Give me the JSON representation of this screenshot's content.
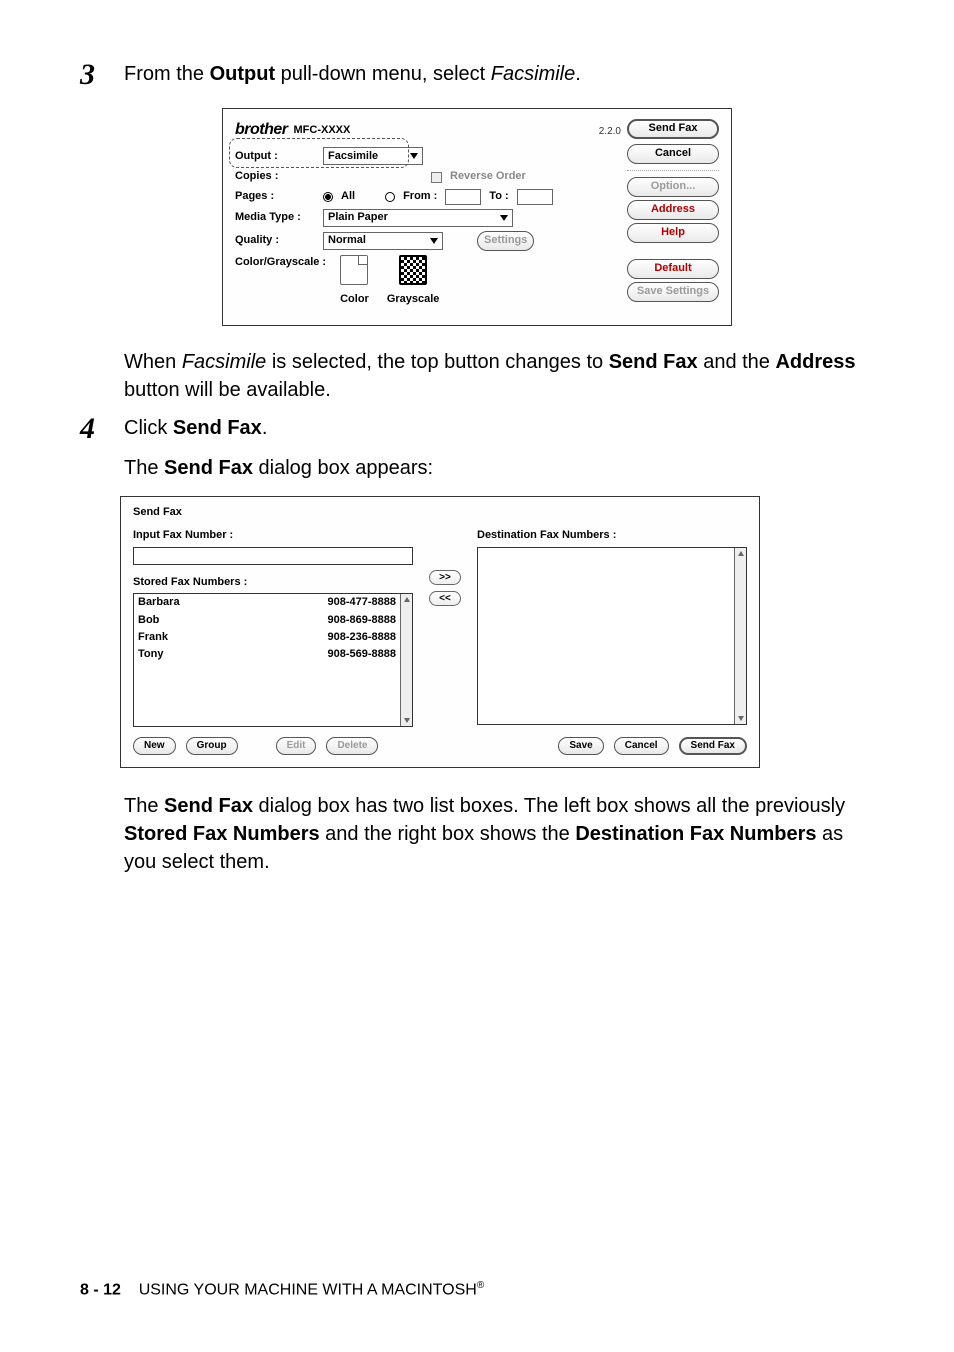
{
  "step3": {
    "num": "3",
    "pre": "From the ",
    "bold1": "Output",
    "mid": " pull-down menu, select ",
    "ital": "Facsimile",
    "post": "."
  },
  "dlg1": {
    "brand": "brother",
    "model": "MFC-XXXX",
    "version": "2.2.0",
    "labels": {
      "output": "Output :",
      "copies": "Copies :",
      "reverse": "Reverse Order",
      "pages": "Pages :",
      "all": "All",
      "from": "From :",
      "to": "To :",
      "media": "Media Type :",
      "quality": "Quality :",
      "settings_btn": "Settings",
      "cg": "Color/Grayscale :",
      "color": "Color",
      "grayscale": "Grayscale"
    },
    "values": {
      "output": "Facsimile",
      "media": "Plain Paper",
      "quality": "Normal"
    },
    "buttons": {
      "sendfax": "Send Fax",
      "cancel": "Cancel",
      "option": "Option...",
      "address": "Address",
      "help": "Help",
      "default": "Default",
      "save": "Save Settings"
    }
  },
  "para1": {
    "pre": "When ",
    "ital": "Facsimile",
    "mid1": " is selected, the top button changes to ",
    "bold1": "Send Fax",
    "mid2": " and the ",
    "bold2": "Address",
    "post": " button will be available."
  },
  "step4": {
    "num": "4",
    "pre": "Click ",
    "bold": "Send Fax",
    "post": "."
  },
  "para2": {
    "pre": "The ",
    "bold": "Send Fax",
    "post": " dialog box appears:"
  },
  "dlg2": {
    "title": "Send Fax",
    "labels": {
      "input": "Input Fax Number :",
      "stored": "Stored Fax Numbers :",
      "dest": "Destination Fax Numbers :",
      "add": ">>",
      "remove": "<<"
    },
    "stored": [
      {
        "name": "Barbara",
        "num": "908-477-8888"
      },
      {
        "name": "Bob",
        "num": "908-869-8888"
      },
      {
        "name": "Frank",
        "num": "908-236-8888"
      },
      {
        "name": "Tony",
        "num": "908-569-8888"
      }
    ],
    "buttons": {
      "new": "New",
      "group": "Group",
      "edit": "Edit",
      "delete": "Delete",
      "save": "Save",
      "cancel": "Cancel",
      "sendfax": "Send Fax"
    }
  },
  "para3": {
    "p1": "The ",
    "b1": "Send Fax",
    "p2": " dialog box has two list boxes. The left box shows all the previously ",
    "b2": "Stored Fax Numbers",
    "p3": " and the right box shows the ",
    "b3": "Destination Fax Numbers",
    "p4": " as you select them."
  },
  "footer": {
    "page": "8 - 12",
    "text": "USING YOUR MACHINE WITH A MACINTOSH",
    "reg": "®"
  }
}
